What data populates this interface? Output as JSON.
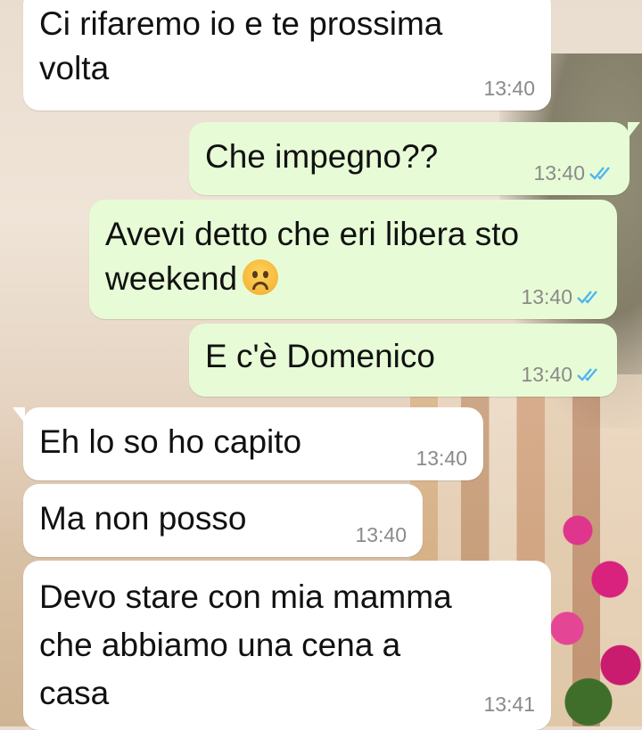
{
  "messages": [
    {
      "id": "m1",
      "dir": "in",
      "text": "Ci rifaremo io e te prossima\nvolta",
      "time": "13:40"
    },
    {
      "id": "m2",
      "dir": "out",
      "text": "Che impegno??",
      "time": "13:40",
      "read": true
    },
    {
      "id": "m3",
      "dir": "out",
      "text": "Avevi detto che eri libera sto\nweekend",
      "emoji": "frowning-face-emoji",
      "time": "13:40",
      "read": true
    },
    {
      "id": "m4",
      "dir": "out",
      "text": "E c'è Domenico",
      "time": "13:40",
      "read": true
    },
    {
      "id": "m5",
      "dir": "in",
      "text": "Eh lo so ho capito",
      "time": "13:40"
    },
    {
      "id": "m6",
      "dir": "in",
      "text": "Ma non posso",
      "time": "13:40"
    },
    {
      "id": "m7",
      "dir": "in",
      "text": "Devo stare con mia mamma\nche abbiamo una cena a\ncasa",
      "time": "13:41"
    }
  ],
  "colors": {
    "incoming": "#ffffff",
    "outgoing": "#e7fcd6",
    "read_ticks": "#4fb6ec",
    "timestamp": "#8a8a8a"
  },
  "icons": {
    "read_receipt": "double-check-icon"
  }
}
